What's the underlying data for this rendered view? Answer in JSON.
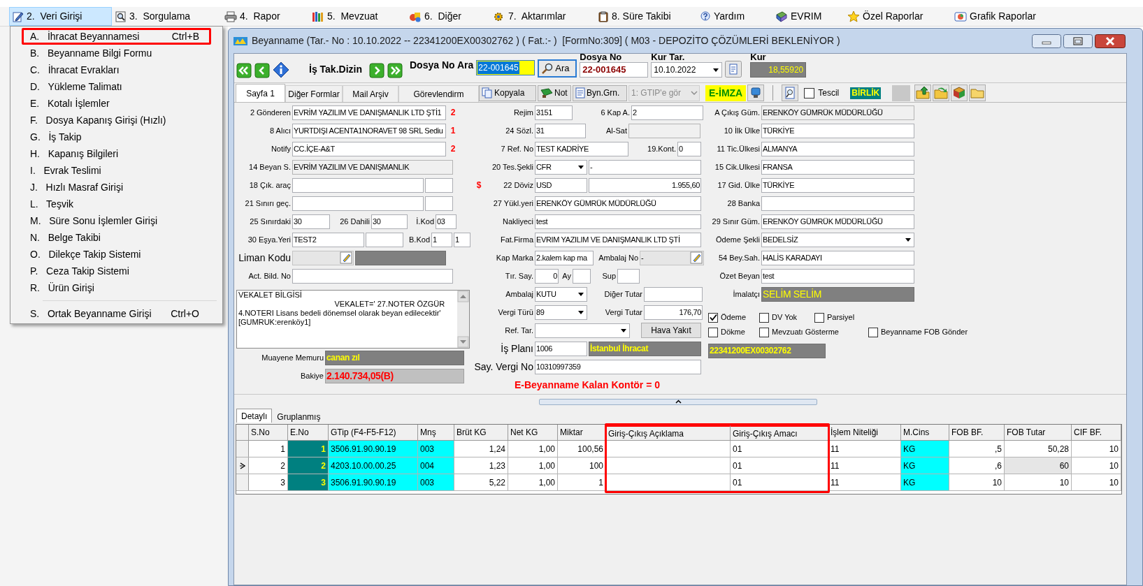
{
  "menu_bar": [
    {
      "label": "2.  Veri Girişi",
      "selected": true
    },
    {
      "label": "3.  Sorgulama",
      "selected": false
    },
    {
      "label": "4.  Rapor",
      "selected": false
    },
    {
      "label": "5.  Mevzuat",
      "selected": false
    },
    {
      "label": "6.  Diğer",
      "selected": false
    },
    {
      "label": "7.  Aktarımlar",
      "selected": false
    },
    {
      "label": "8. Süre Takibi",
      "selected": false
    },
    {
      "label": "Yardım",
      "selected": false
    },
    {
      "label": "EVRIM",
      "selected": false
    },
    {
      "label": "Özel Raporlar",
      "selected": false
    },
    {
      "label": "Grafik Raporlar",
      "selected": false
    }
  ],
  "dropdown": [
    {
      "kind": "item",
      "label": "A.   İhracat Beyannamesi",
      "shortcut": "Ctrl+B",
      "highlighted": true
    },
    {
      "kind": "item",
      "label": "B.   Beyanname Bilgi Formu",
      "highlighted": false
    },
    {
      "kind": "item",
      "label": "C.   İhracat Evrakları",
      "highlighted": false
    },
    {
      "kind": "item",
      "label": "D.   Yükleme Talimatı",
      "highlighted": false
    },
    {
      "kind": "item",
      "label": "E.   Kotalı İşlemler",
      "highlighted": false
    },
    {
      "kind": "item",
      "label": "F.   Dosya Kapanış Girişi (Hızlı)",
      "highlighted": false
    },
    {
      "kind": "item",
      "label": "G.   İş Takip",
      "highlighted": false
    },
    {
      "kind": "item",
      "label": "H.   Kapanış Bilgileri",
      "highlighted": false
    },
    {
      "kind": "item",
      "label": "I.   Evrak Teslimi",
      "highlighted": false
    },
    {
      "kind": "item",
      "label": "J.   Hızlı Masraf Girişi",
      "highlighted": false
    },
    {
      "kind": "item",
      "label": "L.   Teşvik",
      "highlighted": false
    },
    {
      "kind": "item",
      "label": "M.   Süre Sonu İşlemler Girişi",
      "highlighted": false
    },
    {
      "kind": "item",
      "label": "N.   Belge Takibi",
      "highlighted": false
    },
    {
      "kind": "item",
      "label": "O.   Dilekçe Takip Sistemi",
      "highlighted": false
    },
    {
      "kind": "item",
      "label": "P.   Ceza Takip Sistemi",
      "highlighted": false
    },
    {
      "kind": "item",
      "label": "R.   Ürün Girişi",
      "highlighted": false
    },
    {
      "kind": "separator"
    },
    {
      "kind": "item",
      "label": "S.   Ortak Beyanname Girişi",
      "shortcut": "Ctrl+O",
      "highlighted": false
    }
  ],
  "window": {
    "title": "Beyanname (Tar.- No : 10.10.2022 -- 22341200EX00302762 ) ( Fat.:- )  [FormNo:309] ( M03 - DEPOZİTO ÇÖZÜMLERİ BEKLENİYOR )"
  },
  "navigator": {
    "title": "İş Tak.Dizin",
    "search_label": "Dosya No Ara",
    "search_value": "22-001645",
    "search_button": "Ara",
    "file_no_label": "Dosya No",
    "file_no": "22-001645",
    "rate_date_label": "Kur Tar.",
    "rate_date": "10.10.2022",
    "rate_label": "Kur",
    "rate": "18,55920"
  },
  "page_tabs": [
    {
      "label": "Sayfa 1",
      "selected": true
    },
    {
      "label": "Diğer Formlar",
      "selected": false
    },
    {
      "label": "Mail Arşiv",
      "selected": false
    },
    {
      "label": "Görevlendirm",
      "selected": false
    }
  ],
  "toolbar": {
    "buttons": [
      "Kopyala",
      "Not",
      "Byn.Grn."
    ],
    "filter_combo": "1: GTIP'e gör",
    "signature": "E-İMZA",
    "tescil": {
      "label": "Tescil",
      "checked": false
    },
    "badge": "BİRLİK"
  },
  "form": {
    "columns": [
      {
        "rows": [
          {
            "kind": "fields",
            "parts": [
              {
                "kind": "label",
                "text": "2 Gönderen"
              },
              {
                "kind": "input",
                "text": "EVRİM YAZILIM VE DANIŞMANLIK LTD ŞTİ1"
              },
              {
                "kind": "mark",
                "text": "2"
              }
            ]
          },
          {
            "kind": "fields",
            "parts": [
              {
                "kind": "label",
                "text": "8 Alıcı"
              },
              {
                "kind": "input",
                "text": "YURTDIŞI ACENTA1NORAVET 98 SRL Sediu"
              },
              {
                "kind": "mark",
                "text": "1"
              }
            ]
          },
          {
            "kind": "fields",
            "parts": [
              {
                "kind": "label",
                "text": "Notify"
              },
              {
                "kind": "input",
                "text": "CC.İÇE-A&T"
              },
              {
                "kind": "mark",
                "text": "2"
              }
            ]
          },
          {
            "kind": "fields",
            "parts": [
              {
                "kind": "label",
                "text": "14 Beyan S."
              },
              {
                "kind": "readonly",
                "text": "EVRİM YAZILIM VE DANIŞMANLIK"
              }
            ]
          },
          {
            "kind": "fields",
            "parts": [
              {
                "kind": "label",
                "text": "18 Çık. araç"
              },
              {
                "kind": "input"
              },
              {
                "kind": "input"
              }
            ]
          },
          {
            "kind": "fields",
            "parts": [
              {
                "kind": "label",
                "text": "21 Sınırı geç."
              },
              {
                "kind": "input"
              },
              {
                "kind": "input"
              }
            ]
          },
          {
            "kind": "fields",
            "parts": [
              {
                "kind": "label",
                "text": "25 Sınırdaki"
              },
              {
                "kind": "input",
                "text": "30"
              },
              {
                "kind": "label",
                "text": "26 Dahili"
              },
              {
                "kind": "input",
                "text": "30"
              },
              {
                "kind": "label",
                "text": "İ.Kod"
              },
              {
                "kind": "input",
                "text": "03"
              }
            ]
          },
          {
            "kind": "fields",
            "parts": [
              {
                "kind": "label",
                "text": "30 Eşya.Yeri"
              },
              {
                "kind": "input",
                "text": "TEST2"
              },
              {
                "kind": "input"
              },
              {
                "kind": "label",
                "text": "B.Kod"
              },
              {
                "kind": "input",
                "text": "1"
              },
              {
                "kind": "input",
                "text": "1"
              }
            ]
          },
          {
            "kind": "fields",
            "parts": [
              {
                "kind": "big-label",
                "text": "Liman Kodu"
              },
              {
                "kind": "picker"
              },
              {
                "kind": "dark"
              }
            ]
          },
          {
            "kind": "fields",
            "parts": [
              {
                "kind": "label",
                "text": "Act. Bild. No"
              },
              {
                "kind": "input"
              }
            ]
          },
          {
            "kind": "memo",
            "text": "VEKALET BİLGİSİ\n                                             VEKALET=' 27.NOTER ÖZGÜR\n4.NOTERI Lisans bedeli dönemsel olarak beyan edilecektir'\n[GUMRUK:erenköy1]"
          },
          {
            "kind": "fields",
            "parts": [
              {
                "kind": "label",
                "text": "Muayene Memuru"
              },
              {
                "kind": "dark",
                "text": "canan zıl"
              }
            ]
          },
          {
            "kind": "fields",
            "parts": [
              {
                "kind": "label",
                "text": "Bakiye"
              },
              {
                "kind": "balance",
                "text": "2.140.734,05(B)"
              }
            ]
          }
        ]
      },
      {
        "rows": [
          {
            "kind": "fields",
            "parts": [
              {
                "kind": "label",
                "text": "Rejim"
              },
              {
                "kind": "input",
                "text": "3151"
              },
              {
                "kind": "label",
                "text": "6 Kap A."
              },
              {
                "kind": "input",
                "text": "2"
              }
            ]
          },
          {
            "kind": "fields",
            "parts": [
              {
                "kind": "label",
                "text": "24 Sözl."
              },
              {
                "kind": "input",
                "text": "31"
              },
              {
                "kind": "label",
                "text": "Al-Sat"
              },
              {
                "kind": "readonly"
              }
            ]
          },
          {
            "kind": "fields",
            "parts": [
              {
                "kind": "label",
                "text": "7 Ref. No"
              },
              {
                "kind": "input",
                "text": "TEST KADRİYE"
              },
              {
                "kind": "label",
                "text": "19.Kont."
              },
              {
                "kind": "input",
                "text": "0"
              }
            ]
          },
          {
            "kind": "fields",
            "parts": [
              {
                "kind": "label",
                "text": "20 Tes.Şekli"
              },
              {
                "kind": "combo",
                "text": "CFR"
              },
              {
                "kind": "input",
                "text": "-"
              }
            ]
          },
          {
            "kind": "fields",
            "parts": [
              {
                "kind": "mark",
                "text": "$"
              },
              {
                "kind": "label",
                "text": "22 Döviz"
              },
              {
                "kind": "input",
                "text": "USD"
              },
              {
                "kind": "amount",
                "text": "1.955,60"
              }
            ]
          },
          {
            "kind": "fields",
            "parts": [
              {
                "kind": "label",
                "text": "27 Yükl.yeri"
              },
              {
                "kind": "input",
                "text": "ERENKÖY GÜMRÜK MÜDÜRLÜĞÜ"
              }
            ]
          },
          {
            "kind": "fields",
            "parts": [
              {
                "kind": "label",
                "text": "Nakliyeci"
              },
              {
                "kind": "input",
                "text": "test"
              }
            ]
          },
          {
            "kind": "fields",
            "parts": [
              {
                "kind": "label",
                "text": "Fat.Firma"
              },
              {
                "kind": "input",
                "text": "EVRIM YAZILIM VE DANIŞMANLIK LTD ŞTİ"
              }
            ]
          },
          {
            "kind": "fields",
            "parts": [
              {
                "kind": "label",
                "text": "Kap Marka"
              },
              {
                "kind": "input",
                "text": "2.kalem kap ma"
              },
              {
                "kind": "label",
                "text": "Ambalaj No"
              },
              {
                "kind": "picker",
                "text": "-"
              }
            ]
          },
          {
            "kind": "fields",
            "parts": [
              {
                "kind": "label",
                "text": "Tır. Say."
              },
              {
                "kind": "amount",
                "text": "0"
              },
              {
                "kind": "label",
                "text": "Ay"
              },
              {
                "kind": "input"
              },
              {
                "kind": "label",
                "text": "Sup"
              },
              {
                "kind": "input"
              }
            ]
          },
          {
            "kind": "fields",
            "parts": [
              {
                "kind": "label",
                "text": "Ambalaj"
              },
              {
                "kind": "combo",
                "text": "KUTU"
              },
              {
                "kind": "label",
                "text": "Diğer Tutar"
              },
              {
                "kind": "input"
              }
            ]
          },
          {
            "kind": "fields",
            "parts": [
              {
                "kind": "label",
                "text": "Vergi Türü"
              },
              {
                "kind": "combo",
                "text": "89"
              },
              {
                "kind": "label",
                "text": "Vergi Tutar"
              },
              {
                "kind": "amount",
                "text": "176,70"
              }
            ]
          },
          {
            "kind": "fields",
            "parts": [
              {
                "kind": "label",
                "text": "Ref. Tar."
              },
              {
                "kind": "combo"
              },
              {
                "kind": "button",
                "text": "Hava Yakıt"
              }
            ]
          },
          {
            "kind": "fields",
            "parts": [
              {
                "kind": "big-label",
                "text": "İş Planı"
              },
              {
                "kind": "input",
                "text": "1006"
              },
              {
                "kind": "dark",
                "text": "İstanbul İhracat"
              }
            ]
          },
          {
            "kind": "fields",
            "parts": [
              {
                "kind": "big-label",
                "text": "Say. Vergi No"
              },
              {
                "kind": "input",
                "text": "10310997359"
              }
            ]
          },
          {
            "kind": "fields",
            "parts": [
              {
                "kind": "alert",
                "text": "E-Beyanname Kalan Kontör = 0"
              }
            ]
          }
        ]
      },
      {
        "rows": [
          {
            "kind": "fields",
            "parts": [
              {
                "kind": "label",
                "text": "A Çıkış Güm."
              },
              {
                "kind": "readonly",
                "text": "ERENKÖY GÜMRÜK MÜDÜRLÜĞÜ"
              }
            ]
          },
          {
            "kind": "fields",
            "parts": [
              {
                "kind": "label",
                "text": "10 İlk Ülke"
              },
              {
                "kind": "input",
                "text": "TÜRKİYE"
              }
            ]
          },
          {
            "kind": "fields",
            "parts": [
              {
                "kind": "label",
                "text": "11 Tic.Ülkesi"
              },
              {
                "kind": "input",
                "text": "ALMANYA"
              }
            ]
          },
          {
            "kind": "fields",
            "parts": [
              {
                "kind": "label",
                "text": "15 Cik.Ulkesi"
              },
              {
                "kind": "input",
                "text": "FRANSA"
              }
            ]
          },
          {
            "kind": "fields",
            "parts": [
              {
                "kind": "label",
                "text": "17 Gid. Ülke"
              },
              {
                "kind": "input",
                "text": "TÜRKİYE"
              }
            ]
          },
          {
            "kind": "fields",
            "parts": [
              {
                "kind": "label",
                "text": "28 Banka"
              },
              {
                "kind": "input"
              }
            ]
          },
          {
            "kind": "fields",
            "parts": [
              {
                "kind": "label",
                "text": "29 Sınır Güm."
              },
              {
                "kind": "input",
                "text": "ERENKÖY GÜMRÜK MÜDÜRLÜĞÜ"
              }
            ]
          },
          {
            "kind": "fields",
            "parts": [
              {
                "kind": "label",
                "text": "Ödeme Şekli"
              },
              {
                "kind": "combo",
                "text": "BEDELSİZ"
              }
            ]
          },
          {
            "kind": "fields",
            "parts": [
              {
                "kind": "label",
                "text": "54 Bey.Sah."
              },
              {
                "kind": "input",
                "text": "HALİS KARADAYI"
              }
            ]
          },
          {
            "kind": "fields",
            "parts": [
              {
                "kind": "label",
                "text": "Özet Beyan"
              },
              {
                "kind": "input",
                "text": "test"
              }
            ]
          },
          {
            "kind": "fields",
            "parts": [
              {
                "kind": "label",
                "text": "İmalatçı"
              },
              {
                "kind": "dark-plain",
                "text": "SELİM SELİM"
              }
            ]
          },
          {
            "kind": "checks",
            "checks": [
              {
                "label": "Ödeme",
                "checked": true
              },
              {
                "label": "DV Yok",
                "checked": false
              },
              {
                "label": "Parsiyel",
                "checked": false
              }
            ]
          },
          {
            "kind": "checks",
            "checks": [
              {
                "label": "Dökme",
                "checked": false
              },
              {
                "label": "Mevzuatı Gösterme",
                "checked": false
              },
              {
                "label": "Beyanname FOB Gönder",
                "checked": false
              }
            ]
          },
          {
            "kind": "fields",
            "parts": [
              {
                "kind": "dark",
                "text": "22341200EX00302762"
              }
            ]
          }
        ]
      }
    ]
  },
  "detail_tabs": [
    {
      "label": "Detaylı",
      "selected": true
    },
    {
      "label": "Gruplanmış",
      "selected": false
    }
  ],
  "grid": {
    "columns": [
      {
        "label": "S.No",
        "kind": "number",
        "highlighted": false
      },
      {
        "label": "E.No",
        "kind": "key",
        "color": "#008080",
        "highlighted": false
      },
      {
        "label": "GTip (F4-F5-F12)",
        "kind": "text",
        "color": "#00ffff",
        "highlighted": false
      },
      {
        "label": "Mnş",
        "kind": "text",
        "color": "#00ffff",
        "highlighted": false
      },
      {
        "label": "Brüt KG",
        "kind": "number",
        "highlighted": false
      },
      {
        "label": "Net KG",
        "kind": "number",
        "highlighted": false
      },
      {
        "label": "Miktar",
        "kind": "number",
        "highlighted": false
      },
      {
        "label": "Giriş-Çıkış Açıklama",
        "kind": "text",
        "highlighted": true
      },
      {
        "label": "Giriş-Çıkış Amacı",
        "kind": "text",
        "highlighted": true
      },
      {
        "label": "İşlem Niteliği",
        "kind": "text",
        "highlighted": false
      },
      {
        "label": "M.Cins",
        "kind": "text",
        "color": "#00ffff",
        "highlighted": false
      },
      {
        "label": "FOB BF.",
        "kind": "number",
        "highlighted": false
      },
      {
        "label": "FOB Tutar",
        "kind": "number",
        "highlighted": false
      },
      {
        "label": "CIF BF.",
        "kind": "number",
        "highlighted": false
      }
    ],
    "rows": [
      {
        "selected": false,
        "cells": [
          "1",
          "1",
          "3506.91.90.90.19",
          "003",
          "1,24",
          "1,00",
          "100,56",
          null,
          "01",
          "11",
          "KG",
          ",5",
          "50,28",
          "10"
        ]
      },
      {
        "selected": true,
        "cells": [
          "2",
          "2",
          "4203.10.00.00.25",
          "004",
          "1,23",
          "1,00",
          "100",
          null,
          "01",
          "11",
          "KG",
          ",6",
          {
            "text": "60",
            "focused": true
          },
          "10"
        ]
      },
      {
        "selected": false,
        "cells": [
          "3",
          "3",
          "3506.91.90.90.19",
          "003",
          "5,22",
          "1,00",
          "1",
          null,
          "01",
          "11",
          "KG",
          "10",
          "10",
          "10"
        ]
      }
    ]
  }
}
